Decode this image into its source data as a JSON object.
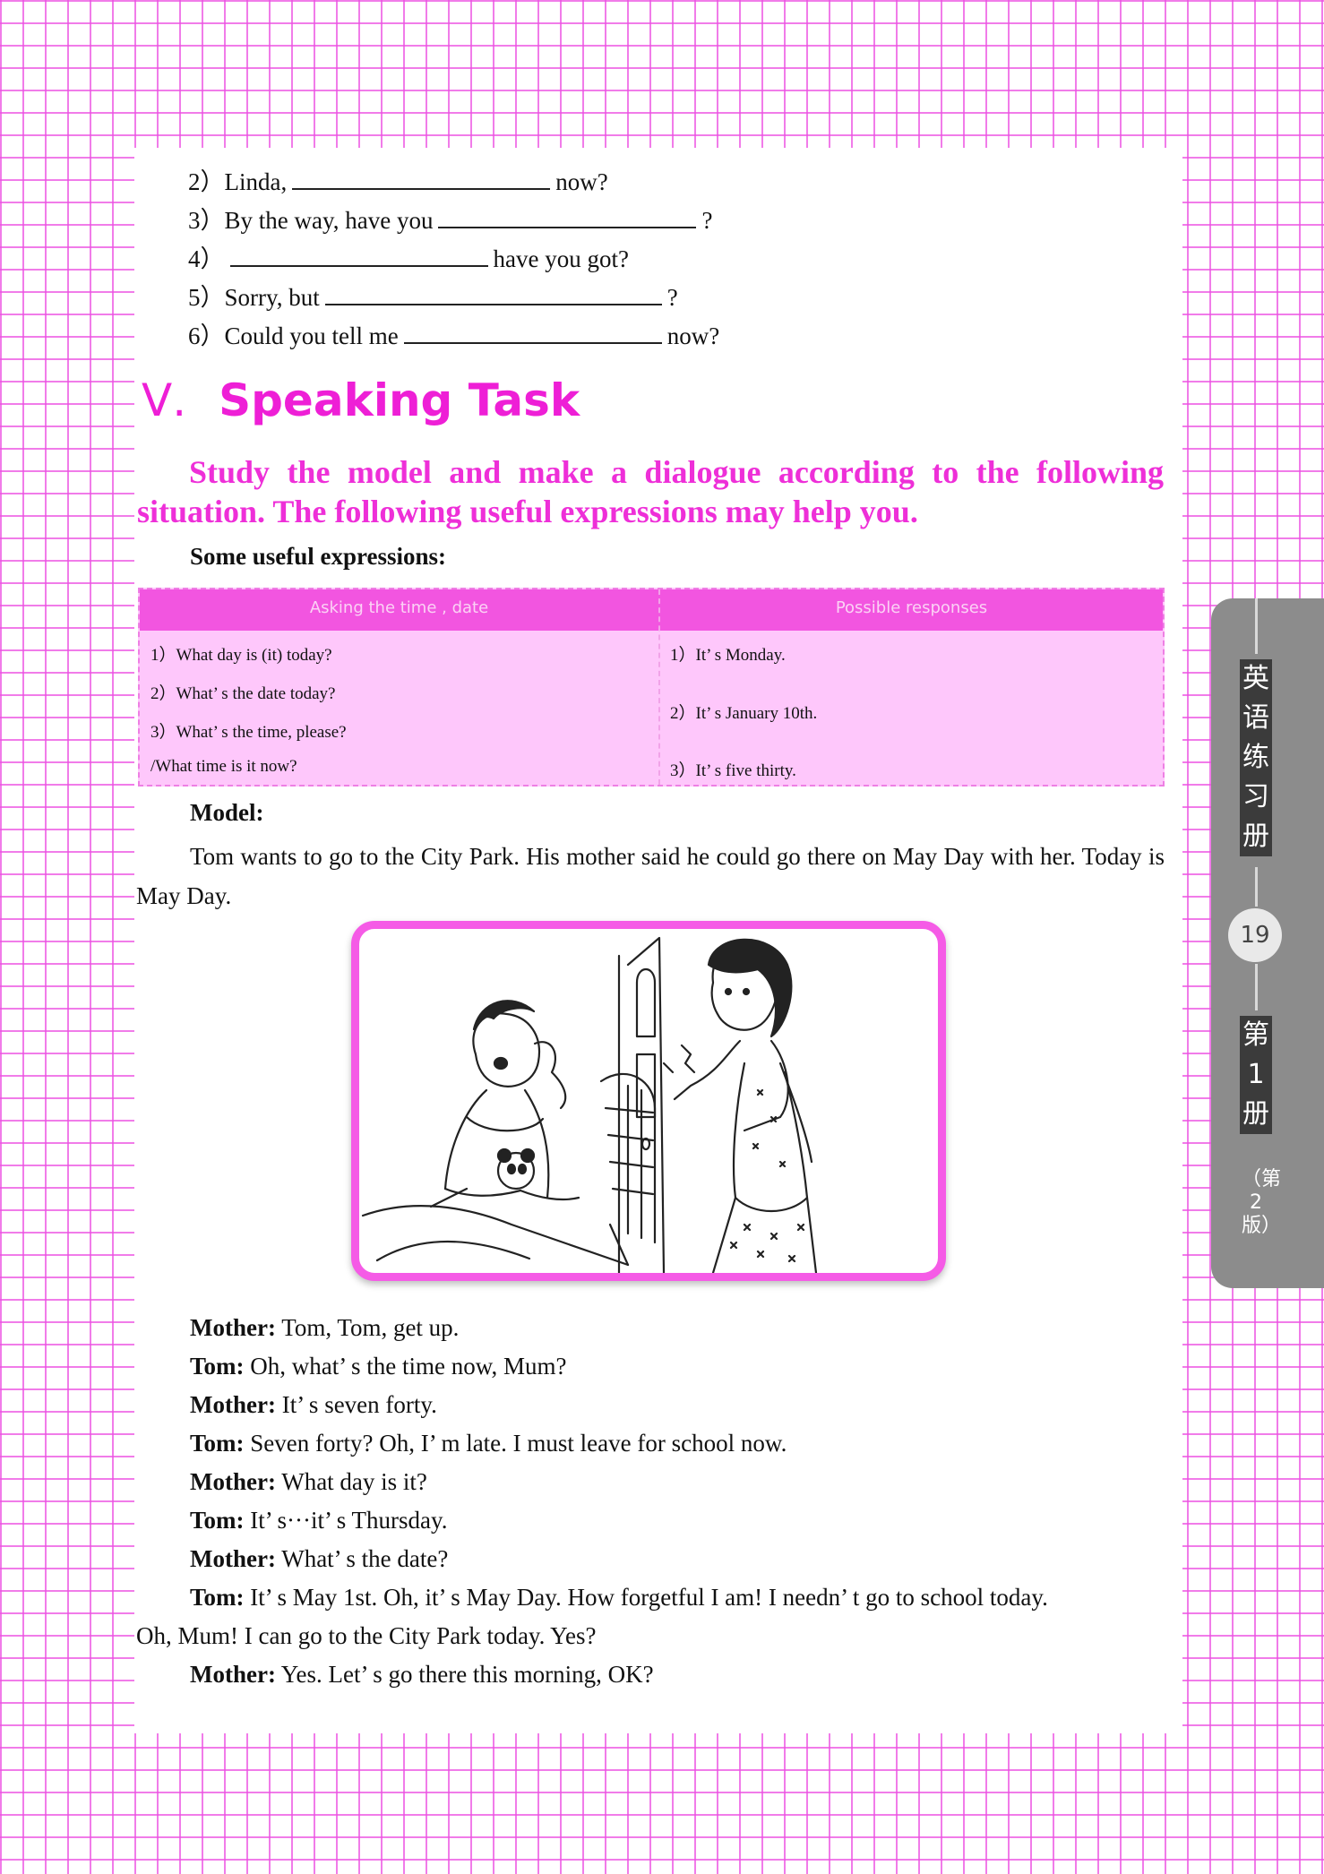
{
  "exercise": {
    "items": [
      {
        "num": "2）",
        "before": "Linda,",
        "after": "now?"
      },
      {
        "num": "3）",
        "before": "By the way, have you",
        "after": "?"
      },
      {
        "num": "4）",
        "before": "",
        "after": "have you got?"
      },
      {
        "num": "5）",
        "before": "Sorry, but",
        "after": "?"
      },
      {
        "num": "6）",
        "before": "Could you tell me",
        "after": "now?"
      }
    ]
  },
  "section": {
    "number": "Ⅴ.",
    "title": "Speaking Task",
    "instruction": "Study the model and make a dialogue according to the following situation. The following useful expressions may help you.",
    "subheading": "Some useful expressions:"
  },
  "table": {
    "headers": [
      "Asking the time , date",
      "Possible responses"
    ],
    "left": [
      "1）What day is (it) today?",
      "2）What’ s the date today?",
      "3）What’ s the time, please?",
      "/What time is it now?"
    ],
    "right": [
      "1）It’ s Monday.",
      "2）It’ s January 10th.",
      "3）It’ s five thirty."
    ]
  },
  "model": {
    "label": "Model:",
    "text": "Tom wants to go to the City Park. His mother said he could go there on May Day with her. Today is May Day."
  },
  "dialogue": [
    {
      "speaker": "Mother:",
      "line": " Tom, Tom, get up."
    },
    {
      "speaker": "Tom:",
      "line": " Oh, what’ s the time now, Mum?"
    },
    {
      "speaker": "Mother:",
      "line": " It’ s seven forty."
    },
    {
      "speaker": "Tom:",
      "line": " Seven forty? Oh, I’ m late. I must leave for school now."
    },
    {
      "speaker": "Mother:",
      "line": " What day is it?"
    },
    {
      "speaker": "Tom:",
      "line": " It’ s···it’ s Thursday."
    },
    {
      "speaker": "Mother:",
      "line": " What’ s the date?"
    },
    {
      "speaker": "Tom:",
      "line": " It’ s May 1st. Oh, it’ s May Day. How forgetful I am! I needn’ t go to school today."
    },
    {
      "speaker": "",
      "line": "Oh, Mum! I can go to the City Park today. Yes?"
    },
    {
      "speaker": "Mother:",
      "line": " Yes. Let’ s go there this morning, OK?"
    }
  ],
  "side_tab": {
    "book_title": "英语练习册",
    "page_number": "19",
    "volume": "第1册",
    "edition": "（第2版）"
  },
  "colors": {
    "accent": "#ee1fd6",
    "grid": "#ec50e2",
    "table_fill": "#fec7fb",
    "tab": "#8c8c8c"
  }
}
